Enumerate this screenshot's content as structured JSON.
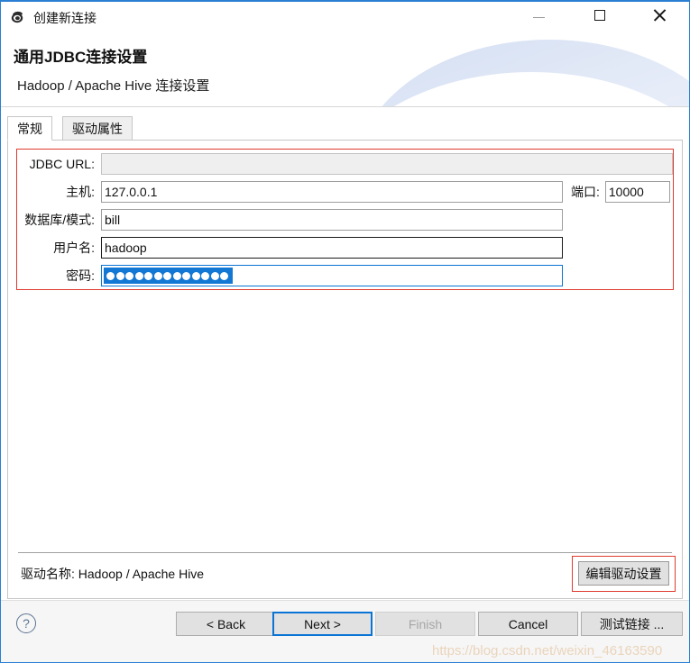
{
  "window": {
    "title": "创建新连接",
    "app_icon": "dbeaver-icon",
    "controls": {
      "minimize": "minimize-icon",
      "maximize": "maximize-icon",
      "close": "close-icon"
    }
  },
  "header": {
    "title": "通用JDBC连接设置",
    "subtitle": "Hadoop / Apache Hive 连接设置"
  },
  "tabs": [
    {
      "label": "常规",
      "active": true
    },
    {
      "label": "驱动属性",
      "active": false
    }
  ],
  "form": {
    "fields": {
      "jdbc_url": {
        "label": "JDBC URL:",
        "value": "",
        "readonly": true
      },
      "host": {
        "label": "主机:",
        "value": "127.0.0.1"
      },
      "port": {
        "label": "端口:",
        "value": "10000"
      },
      "database": {
        "label": "数据库/模式:",
        "value": "bill"
      },
      "username": {
        "label": "用户名:",
        "value": "hadoop"
      },
      "password": {
        "label": "密码:",
        "value": "•••••••••••••",
        "dots": 13,
        "selected": true
      }
    }
  },
  "driver": {
    "label": "驱动名称:",
    "name": "Hadoop / Apache Hive",
    "name_line": "驱动名称: Hadoop / Apache Hive",
    "edit_button": "编辑驱动设置"
  },
  "bottom": {
    "help": "?",
    "buttons": {
      "back": "< Back",
      "next": "Next >",
      "finish": "Finish",
      "cancel": "Cancel",
      "test": "测试链接 ..."
    }
  },
  "watermark": "https://blog.csdn.net/weixin_46163590",
  "colors": {
    "accent": "#0a74d4",
    "annotation": "#e03b2f",
    "window_border": "#2a7fd4",
    "selection": "#1377d4"
  }
}
